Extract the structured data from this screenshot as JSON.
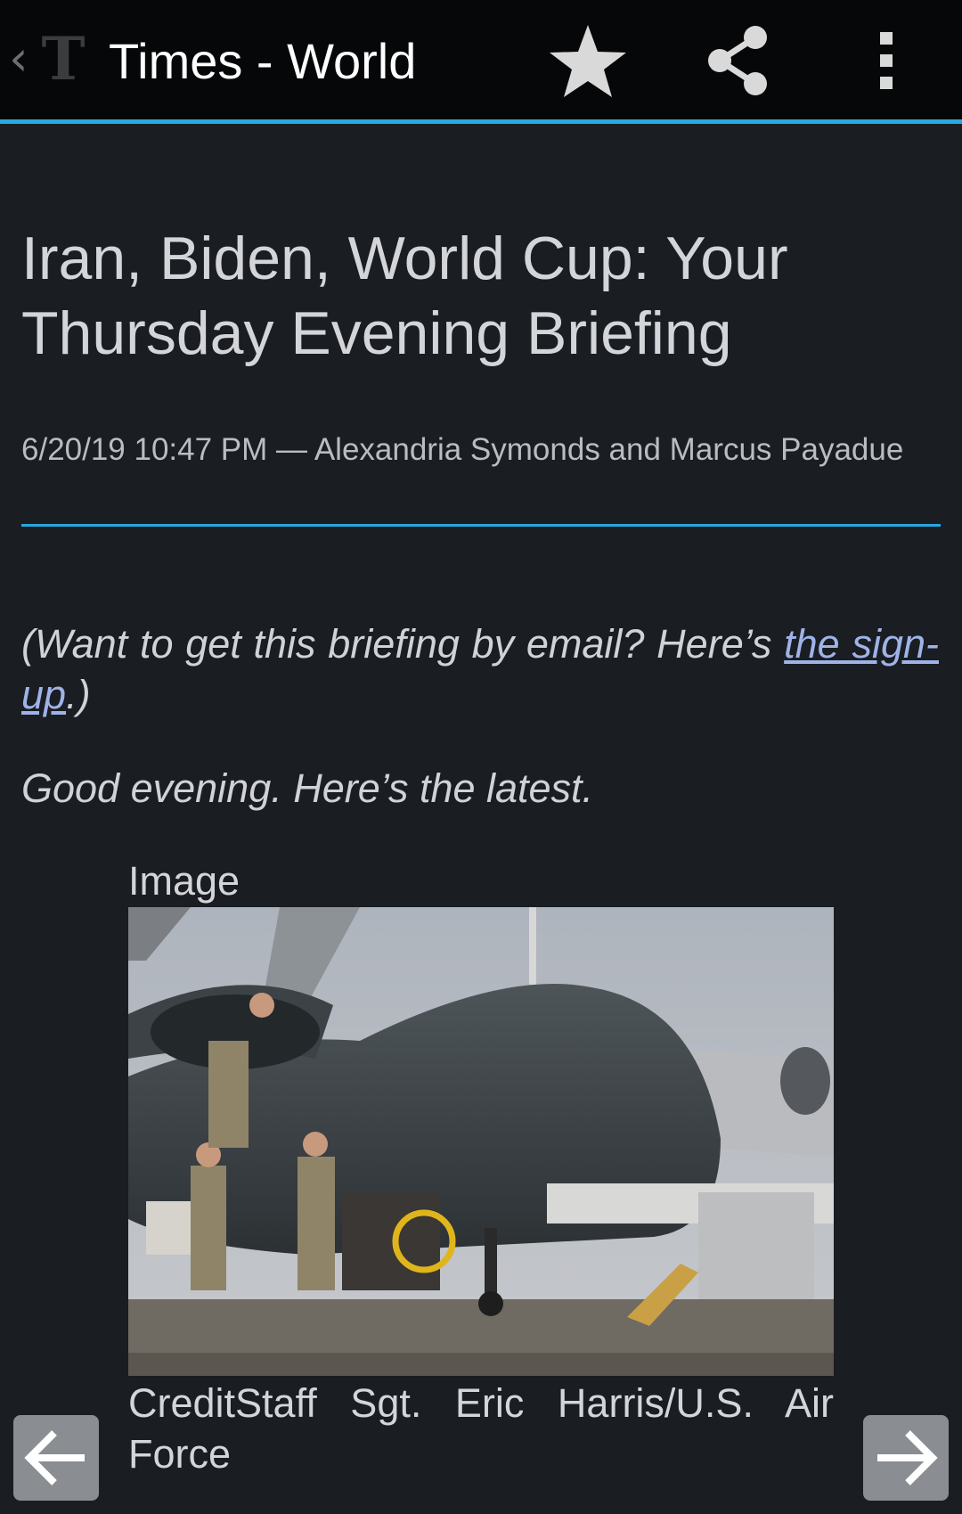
{
  "action_bar": {
    "title": "Times - World",
    "accent_color": "#27a9e1",
    "icons": [
      "back-chevron-icon",
      "nyt-logo-icon",
      "star-icon",
      "share-icon",
      "overflow-menu-icon"
    ]
  },
  "article": {
    "headline": "Iran, Biden, World Cup: Your Thursday Evening Briefing",
    "byline": "6/20/19 10:47 PM — Alexandria Symonds and Marcus Payadue",
    "intro_prefix": "(Want to get this briefing by email? Here’s ",
    "intro_link": "the sign-up",
    "intro_suffix": ".)",
    "greeting": "Good evening. Here’s the latest.",
    "image_label": "Image",
    "image_caption": "CreditStaff Sgt. Eric Harris/U.S. Air Force"
  },
  "navigation": {
    "prev_icon": "arrow-left-icon",
    "next_icon": "arrow-right-icon"
  }
}
